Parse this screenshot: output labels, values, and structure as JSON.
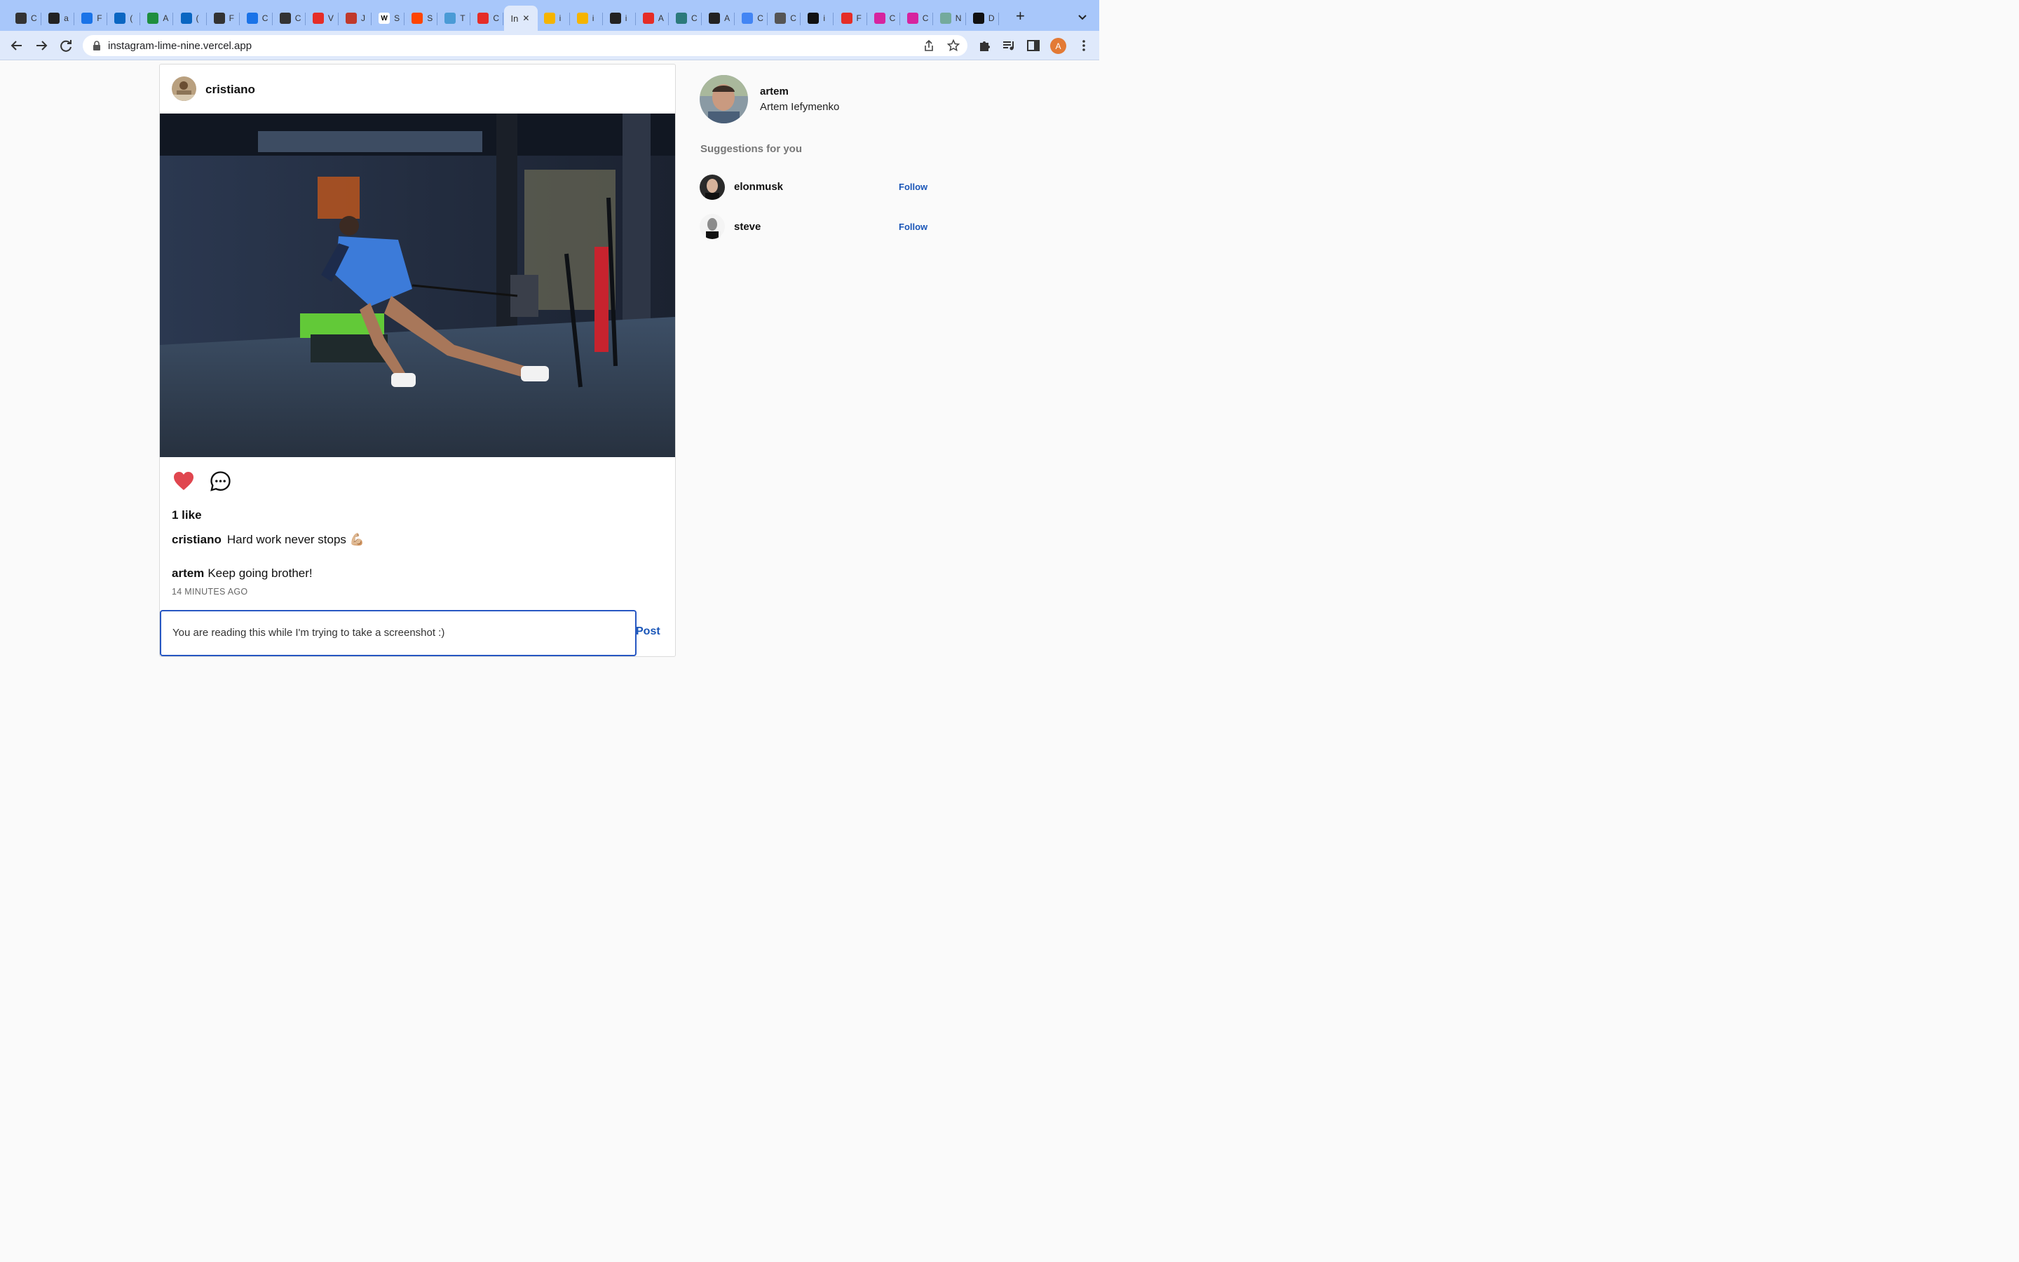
{
  "browser": {
    "tabs": [
      {
        "icon": "plus-circle-icon",
        "label": "C",
        "color": "#333333"
      },
      {
        "icon": "github-icon",
        "label": "a",
        "color": "#222222"
      },
      {
        "icon": "info-icon",
        "label": "F",
        "color": "#1a73e8"
      },
      {
        "icon": "linkedin-icon",
        "label": "(",
        "color": "#0a66c2"
      },
      {
        "icon": "sheets-icon",
        "label": "A",
        "color": "#1e8e3e"
      },
      {
        "icon": "linkedin-icon",
        "label": "(",
        "color": "#0a66c2"
      },
      {
        "icon": "globe-icon",
        "label": "F",
        "color": "#333333"
      },
      {
        "icon": "calendar-icon",
        "label": "C",
        "color": "#1a73e8"
      },
      {
        "icon": "globe-icon",
        "label": "C",
        "color": "#333333"
      },
      {
        "icon": "youtube-icon",
        "label": "V",
        "color": "#e52d27"
      },
      {
        "icon": "openai-icon",
        "label": "J",
        "color": "#c0392b"
      },
      {
        "icon": "wikipedia-icon",
        "label": "S",
        "color": "#ffffff"
      },
      {
        "icon": "reddit-icon",
        "label": "S",
        "color": "#ff4500"
      },
      {
        "icon": "slack-icon",
        "label": "T",
        "color": "#4a9bd6"
      },
      {
        "icon": "youtube-icon",
        "label": "C",
        "color": "#e52d27"
      },
      {
        "icon": "instagram-app-icon",
        "label": "In",
        "color": "#dfe9fb",
        "active": true
      },
      {
        "icon": "firebase-icon",
        "label": "i",
        "color": "#f5b400"
      },
      {
        "icon": "firebase-icon",
        "label": "i",
        "color": "#f5b400"
      },
      {
        "icon": "github-icon",
        "label": "i",
        "color": "#222222"
      },
      {
        "icon": "youtube-icon",
        "label": "A",
        "color": "#e52d27"
      },
      {
        "icon": "c-icon",
        "label": "C",
        "color": "#2c7a7b"
      },
      {
        "icon": "github-icon",
        "label": "A",
        "color": "#222222"
      },
      {
        "icon": "docs-icon",
        "label": "C",
        "color": "#4285f4"
      },
      {
        "icon": "store-icon",
        "label": "C",
        "color": "#555555"
      },
      {
        "icon": "vercel-icon",
        "label": "i",
        "color": "#111111"
      },
      {
        "icon": "youtube-icon",
        "label": "F",
        "color": "#e52d27"
      },
      {
        "icon": "instagram-icon",
        "label": "C",
        "color": "#d6249f"
      },
      {
        "icon": "instagram-icon",
        "label": "C",
        "color": "#d6249f"
      },
      {
        "icon": "chatgpt-icon",
        "label": "N",
        "color": "#74aa9c"
      },
      {
        "icon": "medium-icon",
        "label": "D",
        "color": "#111111"
      }
    ],
    "url": "instagram-lime-nine.vercel.app"
  },
  "post": {
    "author": "cristiano",
    "likes_text": "1 like",
    "caption_author": "cristiano",
    "caption_text": "Hard work never stops 💪🏼",
    "comment_author": "artem",
    "comment_text": "Keep going brother!",
    "timestamp": "14 MINUTES AGO",
    "comment_input_value": "You are reading this while I'm trying to take a screenshot :)",
    "post_label": "Post",
    "liked": true,
    "like_color": "#e0464f"
  },
  "sidebar": {
    "username": "artem",
    "fullname": "Artem Iefymenko",
    "suggestions_title": "Suggestions for you",
    "suggestions": [
      {
        "username": "elonmusk",
        "action": "Follow"
      },
      {
        "username": "steve",
        "action": "Follow"
      }
    ]
  },
  "colors": {
    "accent": "#1a56b8",
    "input_border": "#2757c2"
  }
}
